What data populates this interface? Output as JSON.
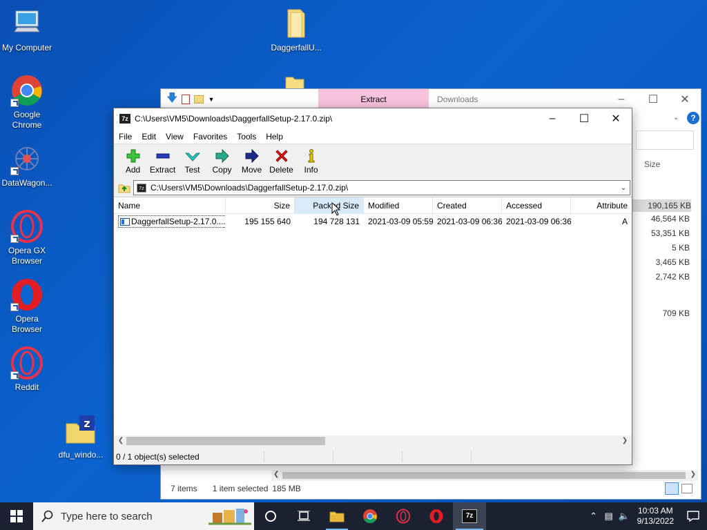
{
  "desktop": {
    "icons": [
      {
        "label": "My Computer"
      },
      {
        "label": "Google\nChrome"
      },
      {
        "label": "DataWagon..."
      },
      {
        "label": "Opera GX\nBrowser"
      },
      {
        "label": "Opera\nBrowser"
      },
      {
        "label": "Reddit"
      },
      {
        "label": "dfu_windo..."
      },
      {
        "label": "DaggerfallU..."
      }
    ]
  },
  "explorer": {
    "extract_tab": "Extract",
    "title": "Downloads",
    "column_size": "Size",
    "sizes": [
      "190,165 KB",
      "46,564 KB",
      "53,351 KB",
      "5 KB",
      "3,465 KB",
      "2,742 KB",
      "709 KB"
    ],
    "status_items": "7 items",
    "status_selected": "1 item selected",
    "status_size": "185 MB"
  },
  "zip": {
    "title": "C:\\Users\\VM5\\Downloads\\DaggerfallSetup-2.17.0.zip\\",
    "menu": [
      "File",
      "Edit",
      "View",
      "Favorites",
      "Tools",
      "Help"
    ],
    "toolbar": {
      "add": "Add",
      "extract": "Extract",
      "test": "Test",
      "copy": "Copy",
      "move": "Move",
      "delete": "Delete",
      "info": "Info"
    },
    "address": "C:\\Users\\VM5\\Downloads\\DaggerfallSetup-2.17.0.zip\\",
    "columns": {
      "name": "Name",
      "size": "Size",
      "packed": "Packed Size",
      "modified": "Modified",
      "created": "Created",
      "accessed": "Accessed",
      "attributes": "Attribute"
    },
    "rows": [
      {
        "name": "DaggerfallSetup-2.17.0....",
        "size": "195 155 640",
        "packed": "194 728 131",
        "modified": "2021-03-09 05:59",
        "created": "2021-03-09 06:36",
        "accessed": "2021-03-09 06:36",
        "attr": "A"
      }
    ],
    "status": "0 / 1 object(s) selected"
  },
  "taskbar": {
    "search_placeholder": "Type here to search",
    "time": "10:03 AM",
    "date": "9/13/2022"
  },
  "colors": {
    "taskbar": "#1b2130",
    "desktop": "#0b63cf",
    "extract_tab": "#f7c3dc"
  }
}
